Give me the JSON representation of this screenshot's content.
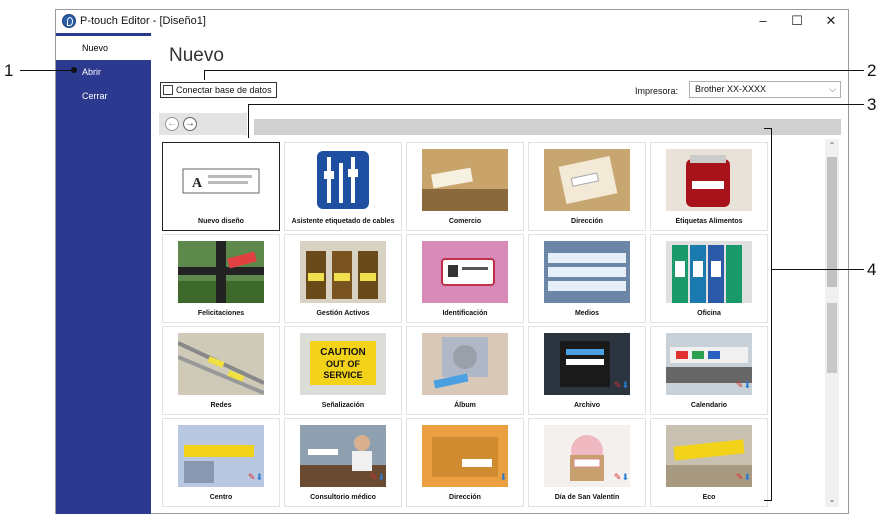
{
  "window": {
    "title": "P-touch Editor - [Diseño1]",
    "minimize": "–",
    "maximize": "☐",
    "close": "✕"
  },
  "sidebar": {
    "items": [
      {
        "label": "Nuevo",
        "active": true
      },
      {
        "label": "Abrir",
        "active": false
      },
      {
        "label": "Cerrar",
        "active": false
      }
    ]
  },
  "main": {
    "title": "Nuevo",
    "db_checkbox_label": "Conectar base de datos",
    "printer_label": "Impresora:",
    "printer_value": "Brother XX-XXXX",
    "nav_back": "←",
    "nav_forward": "→"
  },
  "tiles": [
    {
      "label": "Nuevo diseño",
      "icon": "new-layout-icon"
    },
    {
      "label": "Asistente etiquetado de cables",
      "icon": "cable-wizard-icon"
    },
    {
      "label": "Comercio",
      "icon": "commerce-photo"
    },
    {
      "label": "Dirección",
      "icon": "address-photo"
    },
    {
      "label": "Etiquetas Alimentos",
      "icon": "food-labels-photo"
    },
    {
      "label": "Felicitaciones",
      "icon": "greetings-photo"
    },
    {
      "label": "Gestión Activos",
      "icon": "asset-management-photo"
    },
    {
      "label": "Identificación",
      "icon": "identification-photo"
    },
    {
      "label": "Medios",
      "icon": "media-photo"
    },
    {
      "label": "Oficina",
      "icon": "office-photo"
    },
    {
      "label": "Redes",
      "icon": "networks-photo"
    },
    {
      "label": "Señalización",
      "icon": "signage-photo"
    },
    {
      "label": "Álbum",
      "icon": "album-photo"
    },
    {
      "label": "Archivo",
      "icon": "archive-photo"
    },
    {
      "label": "Calendario",
      "icon": "calendar-photo"
    },
    {
      "label": "Centro",
      "icon": "center-photo"
    },
    {
      "label": "Consultorio médico",
      "icon": "medical-office-photo"
    },
    {
      "label": "Dirección",
      "icon": "address2-photo"
    },
    {
      "label": "Día de San Valentín",
      "icon": "valentines-photo"
    },
    {
      "label": "Eco",
      "icon": "eco-photo"
    }
  ],
  "signage_text": [
    "CAUTION",
    "OUT OF",
    "SERVICE"
  ],
  "callouts": [
    "1",
    "2",
    "3",
    "4"
  ],
  "colors": {
    "sidebar_bg": "#2b3a8f",
    "accent_blue": "#1e4fa0"
  }
}
